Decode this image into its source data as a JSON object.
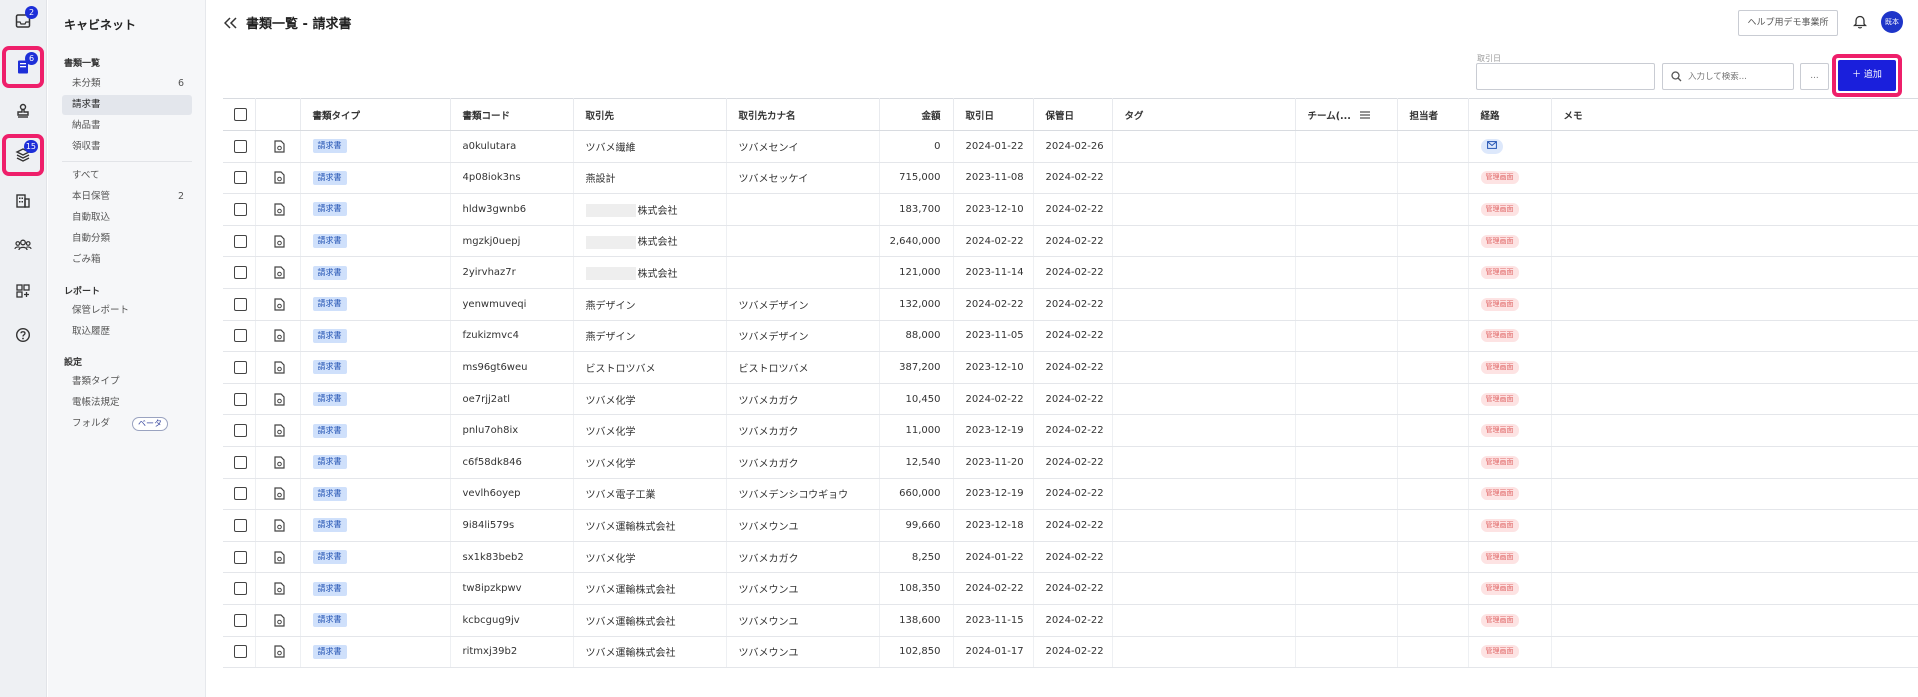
{
  "rail": {
    "inbox_badge": "2",
    "docs_badge": "6",
    "layers_badge": "15"
  },
  "sidebar": {
    "title": "キャビネット",
    "sections": [
      {
        "heading": "書類一覧",
        "items": [
          {
            "label": "未分類",
            "count": "6"
          },
          {
            "label": "請求書",
            "count": ""
          },
          {
            "label": "納品書",
            "count": ""
          },
          {
            "label": "領収書",
            "count": ""
          }
        ]
      },
      {
        "heading": "",
        "items": [
          {
            "label": "すべて",
            "count": ""
          },
          {
            "label": "本日保管",
            "count": "2"
          },
          {
            "label": "自動取込",
            "count": ""
          },
          {
            "label": "自動分類",
            "count": ""
          },
          {
            "label": "ごみ箱",
            "count": ""
          }
        ]
      },
      {
        "heading": "レポート",
        "items": [
          {
            "label": "保管レポート",
            "count": ""
          },
          {
            "label": "取込履歴",
            "count": ""
          }
        ]
      },
      {
        "heading": "設定",
        "items": [
          {
            "label": "書類タイプ",
            "count": ""
          },
          {
            "label": "電帳法規定",
            "count": ""
          },
          {
            "label": "フォルダ",
            "count": ""
          }
        ]
      }
    ],
    "beta_label": "ベータ"
  },
  "header": {
    "title": "書類一覧 - 請求書",
    "help_button": "ヘルプ用デモ事業所",
    "avatar": "既本"
  },
  "toolbar": {
    "date_label": "取引日",
    "search_placeholder": "入力して検索...",
    "more_label": "...",
    "add_label": "＋ 追加"
  },
  "table": {
    "columns": [
      "",
      "",
      "書類タイプ",
      "書類コード",
      "取引先",
      "取引先カナ名",
      "金額",
      "取引日",
      "保管日",
      "タグ",
      "チーム(...",
      "担当者",
      "経路",
      "メモ"
    ],
    "rows": [
      {
        "type": "請求書",
        "code": "a0kulutara",
        "partner": "ツバメ繊維",
        "kana": "ツバメセンイ",
        "amount": "0",
        "date": "2024-01-22",
        "stored": "2024-02-26",
        "route": "mail",
        "blurred": false
      },
      {
        "type": "請求書",
        "code": "4p08iok3ns",
        "partner": "燕設計",
        "kana": "ツバメセッケイ",
        "amount": "715,000",
        "date": "2023-11-08",
        "stored": "2024-02-22",
        "route": "管理画面",
        "blurred": false
      },
      {
        "type": "請求書",
        "code": "hldw3gwnb6",
        "partner": "株式会社",
        "kana": "",
        "amount": "183,700",
        "date": "2023-12-10",
        "stored": "2024-02-22",
        "route": "管理画面",
        "blurred": true
      },
      {
        "type": "請求書",
        "code": "mgzkj0uepj",
        "partner": "株式会社",
        "kana": "",
        "amount": "2,640,000",
        "date": "2024-02-22",
        "stored": "2024-02-22",
        "route": "管理画面",
        "blurred": true
      },
      {
        "type": "請求書",
        "code": "2yirvhaz7r",
        "partner": "株式会社",
        "kana": "",
        "amount": "121,000",
        "date": "2023-11-14",
        "stored": "2024-02-22",
        "route": "管理画面",
        "blurred": true
      },
      {
        "type": "請求書",
        "code": "yenwmuveqi",
        "partner": "燕デザイン",
        "kana": "ツバメデザイン",
        "amount": "132,000",
        "date": "2024-02-22",
        "stored": "2024-02-22",
        "route": "管理画面",
        "blurred": false
      },
      {
        "type": "請求書",
        "code": "fzukizmvc4",
        "partner": "燕デザイン",
        "kana": "ツバメデザイン",
        "amount": "88,000",
        "date": "2023-11-05",
        "stored": "2024-02-22",
        "route": "管理画面",
        "blurred": false
      },
      {
        "type": "請求書",
        "code": "ms96gt6weu",
        "partner": "ビストロツバメ",
        "kana": "ビストロツバメ",
        "amount": "387,200",
        "date": "2023-12-10",
        "stored": "2024-02-22",
        "route": "管理画面",
        "blurred": false
      },
      {
        "type": "請求書",
        "code": "oe7rjj2atl",
        "partner": "ツバメ化学",
        "kana": "ツバメカガク",
        "amount": "10,450",
        "date": "2024-02-22",
        "stored": "2024-02-22",
        "route": "管理画面",
        "blurred": false
      },
      {
        "type": "請求書",
        "code": "pnlu7oh8ix",
        "partner": "ツバメ化学",
        "kana": "ツバメカガク",
        "amount": "11,000",
        "date": "2023-12-19",
        "stored": "2024-02-22",
        "route": "管理画面",
        "blurred": false
      },
      {
        "type": "請求書",
        "code": "c6f58dk846",
        "partner": "ツバメ化学",
        "kana": "ツバメカガク",
        "amount": "12,540",
        "date": "2023-11-20",
        "stored": "2024-02-22",
        "route": "管理画面",
        "blurred": false
      },
      {
        "type": "請求書",
        "code": "vevlh6oyep",
        "partner": "ツバメ電子工業",
        "kana": "ツバメデンシコウギョウ",
        "amount": "660,000",
        "date": "2023-12-19",
        "stored": "2024-02-22",
        "route": "管理画面",
        "blurred": false
      },
      {
        "type": "請求書",
        "code": "9i84li579s",
        "partner": "ツバメ運輸株式会社",
        "kana": "ツバメウンユ",
        "amount": "99,660",
        "date": "2023-12-18",
        "stored": "2024-02-22",
        "route": "管理画面",
        "blurred": false
      },
      {
        "type": "請求書",
        "code": "sx1k83beb2",
        "partner": "ツバメ化学",
        "kana": "ツバメカガク",
        "amount": "8,250",
        "date": "2024-01-22",
        "stored": "2024-02-22",
        "route": "管理画面",
        "blurred": false
      },
      {
        "type": "請求書",
        "code": "tw8ipzkpwv",
        "partner": "ツバメ運輸株式会社",
        "kana": "ツバメウンユ",
        "amount": "108,350",
        "date": "2024-02-22",
        "stored": "2024-02-22",
        "route": "管理画面",
        "blurred": false
      },
      {
        "type": "請求書",
        "code": "kcbcgug9jv",
        "partner": "ツバメ運輸株式会社",
        "kana": "ツバメウンユ",
        "amount": "138,600",
        "date": "2023-11-15",
        "stored": "2024-02-22",
        "route": "管理画面",
        "blurred": false
      },
      {
        "type": "請求書",
        "code": "ritmxj39b2",
        "partner": "ツバメ運輸株式会社",
        "kana": "ツバメウンユ",
        "amount": "102,850",
        "date": "2024-01-17",
        "stored": "2024-02-22",
        "route": "管理画面",
        "blurred": false
      }
    ]
  }
}
